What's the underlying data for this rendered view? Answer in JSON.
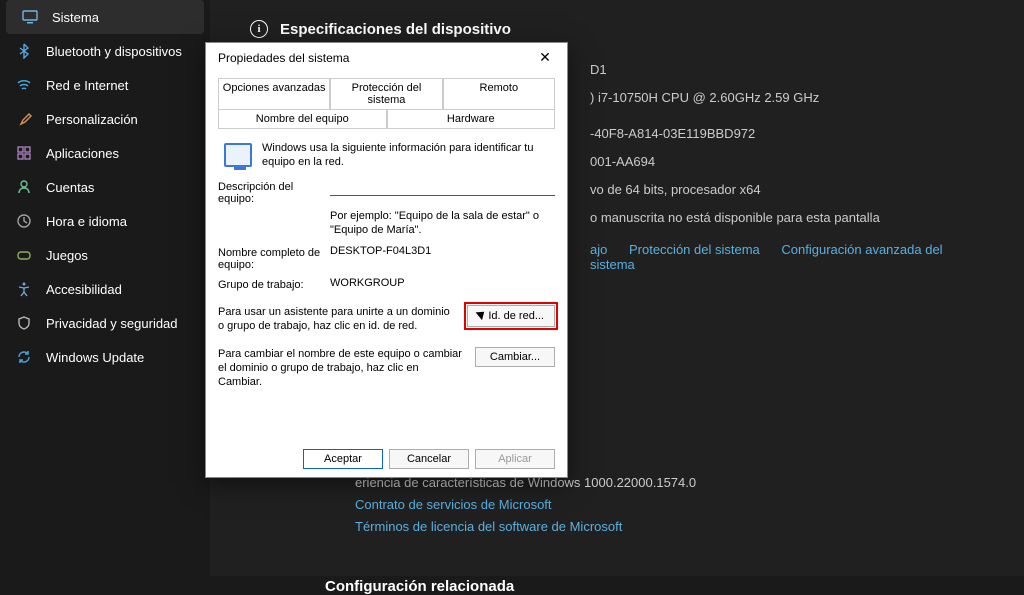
{
  "sidebar": {
    "items": [
      {
        "label": "Sistema",
        "icon": "system"
      },
      {
        "label": "Bluetooth y dispositivos",
        "icon": "bluetooth"
      },
      {
        "label": "Red e Internet",
        "icon": "wifi"
      },
      {
        "label": "Personalización",
        "icon": "brush"
      },
      {
        "label": "Aplicaciones",
        "icon": "apps"
      },
      {
        "label": "Cuentas",
        "icon": "person"
      },
      {
        "label": "Hora e idioma",
        "icon": "clock"
      },
      {
        "label": "Juegos",
        "icon": "game"
      },
      {
        "label": "Accesibilidad",
        "icon": "access"
      },
      {
        "label": "Privacidad y seguridad",
        "icon": "shield"
      },
      {
        "label": "Windows Update",
        "icon": "update"
      }
    ]
  },
  "main": {
    "title": "Especificaciones del dispositivo",
    "specs": {
      "device_suffix": "D1",
      "cpu": ") i7-10750H CPU @ 2.60GHz   2.59 GHz",
      "uuid": "-40F8-A814-03E119BBD972",
      "product": "001-AA694",
      "arch": "vo de 64 bits, procesador x64",
      "pen": "o manuscrita no está disponible para esta pantalla"
    },
    "links": {
      "l1": "ajo",
      "l2": "Protección del sistema",
      "l3": "Configuración avanzada del sistema"
    },
    "experience": "eriencia de características de Windows 1000.22000.1574.0",
    "mslinks": {
      "a": "Contrato de servicios de Microsoft",
      "b": "Términos de licencia del software de Microsoft"
    },
    "related": "Configuración relacionada"
  },
  "dialog": {
    "title": "Propiedades del sistema",
    "tabs": {
      "adv": "Opciones avanzadas",
      "prot": "Protección del sistema",
      "rem": "Remoto",
      "name": "Nombre del equipo",
      "hw": "Hardware"
    },
    "intro": "Windows usa la siguiente información para identificar tu equipo en la red.",
    "desc_label": "Descripción del equipo:",
    "desc_value": "",
    "example": "Por ejemplo: \"Equipo de la sala de estar\" o \"Equipo de María\".",
    "fullname_label": "Nombre completo de equipo:",
    "fullname": "DESKTOP-F04L3D1",
    "wg_label": "Grupo de trabajo:",
    "wg": "WORKGROUP",
    "wizard_text": "Para usar un asistente para unirte a un dominio o grupo de trabajo, haz clic en id. de red.",
    "btn_netid": "Id. de red...",
    "change_text": "Para cambiar el nombre de este equipo o cambiar el dominio o grupo de trabajo, haz clic en Cambiar.",
    "btn_change": "Cambiar...",
    "btn_ok": "Aceptar",
    "btn_cancel": "Cancelar",
    "btn_apply": "Aplicar"
  }
}
